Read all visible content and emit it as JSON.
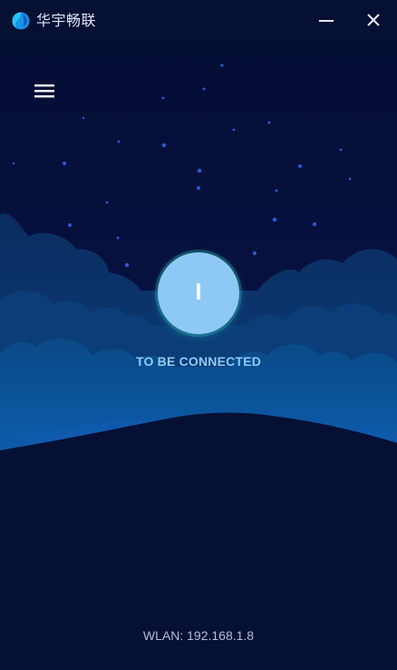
{
  "window": {
    "title": "华宇畅联",
    "logo_icon": "globe-logo-icon",
    "minimize_icon": "minimize-icon",
    "close_icon": "close-icon"
  },
  "menu": {
    "icon": "hamburger-menu-icon"
  },
  "connection": {
    "button_icon": "power-icon",
    "status": "TO BE CONNECTED"
  },
  "footer": {
    "network": "WLAN: 192.168.1.8"
  },
  "colors": {
    "background": "#050f35",
    "cloud_dark": "#0b3a72",
    "cloud_light": "#0e5ea6",
    "accent": "#8ec9f6",
    "status_text": "#8ecbf8"
  }
}
